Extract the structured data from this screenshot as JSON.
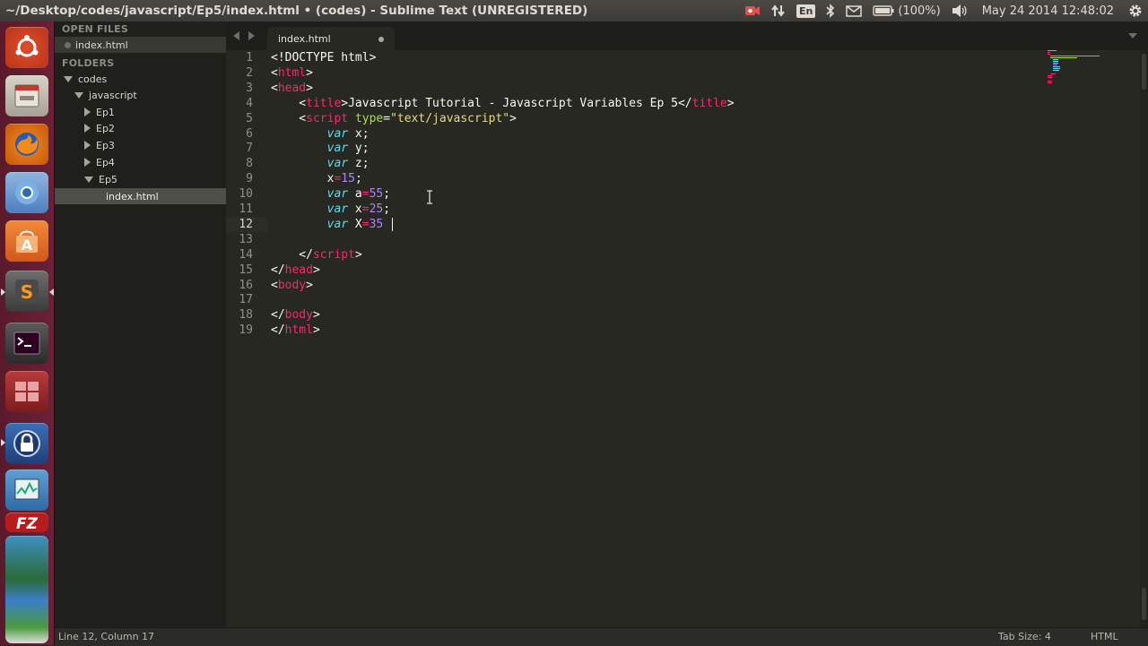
{
  "window": {
    "title": "~/Desktop/codes/javascript/Ep5/index.html • (codes) - Sublime Text (UNREGISTERED)"
  },
  "indicators": {
    "keyboard": "En",
    "battery": "(100%)",
    "clock": "May 24 2014 12:48:02"
  },
  "launcher": {
    "items": [
      "ubuntu-dash-icon",
      "file-manager-icon",
      "firefox-icon",
      "chromium-icon",
      "software-center-icon",
      "sublime-text-icon",
      "terminal-icon",
      "workspace-switcher-icon",
      "keyring-lock-icon",
      "system-monitor-icon",
      "filezilla-icon",
      "stacked-apps-icon"
    ]
  },
  "sidebar": {
    "open_files_header": "OPEN FILES",
    "open_files": [
      "index.html"
    ],
    "folders_header": "FOLDERS",
    "tree": [
      {
        "label": "codes",
        "expanded": true,
        "depth": 0
      },
      {
        "label": "javascript",
        "expanded": true,
        "depth": 1
      },
      {
        "label": "Ep1",
        "expanded": false,
        "depth": 2
      },
      {
        "label": "Ep2",
        "expanded": false,
        "depth": 2
      },
      {
        "label": "Ep3",
        "expanded": false,
        "depth": 2
      },
      {
        "label": "Ep4",
        "expanded": false,
        "depth": 2
      },
      {
        "label": "Ep5",
        "expanded": true,
        "depth": 2
      },
      {
        "label": "index.html",
        "selected": true,
        "depth": 3
      }
    ]
  },
  "editor": {
    "tab": {
      "label": "index.html",
      "modified": true
    },
    "current_line": 12,
    "lines": [
      {
        "n": "1",
        "parts": [
          [
            "plain",
            "<!DOCTYPE html>"
          ]
        ]
      },
      {
        "n": "2",
        "parts": [
          [
            "plain",
            "<"
          ],
          [
            "tag",
            "html"
          ],
          [
            "plain",
            ">"
          ]
        ]
      },
      {
        "n": "3",
        "parts": [
          [
            "plain",
            "<"
          ],
          [
            "tag",
            "head"
          ],
          [
            "plain",
            ">"
          ]
        ]
      },
      {
        "n": "4",
        "parts": [
          [
            "plain",
            "    <"
          ],
          [
            "tag",
            "title"
          ],
          [
            "plain",
            ">Javascript Tutorial - Javascript Variables Ep 5</"
          ],
          [
            "tag",
            "title"
          ],
          [
            "plain",
            ">"
          ]
        ]
      },
      {
        "n": "5",
        "parts": [
          [
            "plain",
            "    <"
          ],
          [
            "tag",
            "script"
          ],
          [
            "plain",
            " "
          ],
          [
            "attr",
            "type"
          ],
          [
            "plain",
            "="
          ],
          [
            "str",
            "\"text/javascript\""
          ],
          [
            "plain",
            ">"
          ]
        ]
      },
      {
        "n": "6",
        "parts": [
          [
            "plain",
            "        "
          ],
          [
            "kw",
            "var"
          ],
          [
            "plain",
            " x;"
          ]
        ]
      },
      {
        "n": "7",
        "parts": [
          [
            "plain",
            "        "
          ],
          [
            "kw",
            "var"
          ],
          [
            "plain",
            " y;"
          ]
        ]
      },
      {
        "n": "8",
        "parts": [
          [
            "plain",
            "        "
          ],
          [
            "kw",
            "var"
          ],
          [
            "plain",
            " z;"
          ]
        ]
      },
      {
        "n": "9",
        "parts": [
          [
            "plain",
            "        x"
          ],
          [
            "op",
            "="
          ],
          [
            "num",
            "15"
          ],
          [
            "plain",
            ";"
          ]
        ]
      },
      {
        "n": "10",
        "parts": [
          [
            "plain",
            "        "
          ],
          [
            "kw",
            "var"
          ],
          [
            "plain",
            " a"
          ],
          [
            "op",
            "="
          ],
          [
            "num",
            "55"
          ],
          [
            "plain",
            ";"
          ]
        ]
      },
      {
        "n": "11",
        "parts": [
          [
            "plain",
            "        "
          ],
          [
            "kw",
            "var"
          ],
          [
            "plain",
            " x"
          ],
          [
            "op",
            "="
          ],
          [
            "num",
            "25"
          ],
          [
            "plain",
            ";"
          ]
        ]
      },
      {
        "n": "12",
        "parts": [
          [
            "plain",
            "        "
          ],
          [
            "kw",
            "var"
          ],
          [
            "plain",
            " X"
          ],
          [
            "op",
            "="
          ],
          [
            "num",
            "35"
          ]
        ]
      },
      {
        "n": "13",
        "parts": []
      },
      {
        "n": "14",
        "parts": [
          [
            "plain",
            "    </"
          ],
          [
            "tag",
            "script"
          ],
          [
            "plain",
            ">"
          ]
        ]
      },
      {
        "n": "15",
        "parts": [
          [
            "plain",
            "</"
          ],
          [
            "tag",
            "head"
          ],
          [
            "plain",
            ">"
          ]
        ]
      },
      {
        "n": "16",
        "parts": [
          [
            "plain",
            "<"
          ],
          [
            "tag",
            "body"
          ],
          [
            "plain",
            ">"
          ]
        ]
      },
      {
        "n": "17",
        "parts": []
      },
      {
        "n": "18",
        "parts": [
          [
            "plain",
            "</"
          ],
          [
            "tag",
            "body"
          ],
          [
            "plain",
            ">"
          ]
        ]
      },
      {
        "n": "19",
        "parts": [
          [
            "plain",
            "</"
          ],
          [
            "tag",
            "html"
          ],
          [
            "plain",
            ">"
          ]
        ]
      }
    ]
  },
  "status": {
    "position": "Line 12, Column 17",
    "tab_size": "Tab Size: 4",
    "syntax": "HTML"
  },
  "colors": {
    "editor_bg": "#272822",
    "tag": "#f92672",
    "attr": "#a6e22e",
    "string": "#e6db74",
    "keyword": "#66d9ef",
    "number": "#ae81ff",
    "launcher_bg": "#6b2036"
  }
}
